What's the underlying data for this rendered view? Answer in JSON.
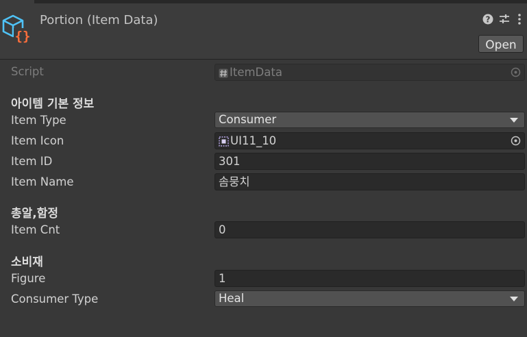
{
  "header": {
    "title": "Portion (Item Data)",
    "open_label": "Open",
    "icons": [
      "scriptable-object-icon",
      "help-icon",
      "presets-icon",
      "kebab-menu-icon"
    ]
  },
  "fields": {
    "script": {
      "label": "Script",
      "value": "ItemData",
      "icon": "script-hash-icon"
    },
    "section_basic": "아이템 기본 정보",
    "item_type": {
      "label": "Item Type",
      "value": "Consumer"
    },
    "item_icon": {
      "label": "Item Icon",
      "value": "UI11_10",
      "icon": "sprite-icon"
    },
    "item_id": {
      "label": "Item ID",
      "value": "301"
    },
    "item_name": {
      "label": "Item Name",
      "value": "솜뭉치"
    },
    "section_gun": "총알,함정",
    "item_cnt": {
      "label": "Item Cnt",
      "value": "0"
    },
    "section_consumable": "소비재",
    "figure": {
      "label": "Figure",
      "value": "1"
    },
    "consumer_type": {
      "label": "Consumer Type",
      "value": "Heal"
    }
  },
  "colors": {
    "background": "#383838",
    "header": "#3c3c3c",
    "field": "#2a2a2a",
    "dropdown": "#515151",
    "icon_cyan": "#4fc3f7",
    "icon_orange": "#ff6f3c"
  }
}
